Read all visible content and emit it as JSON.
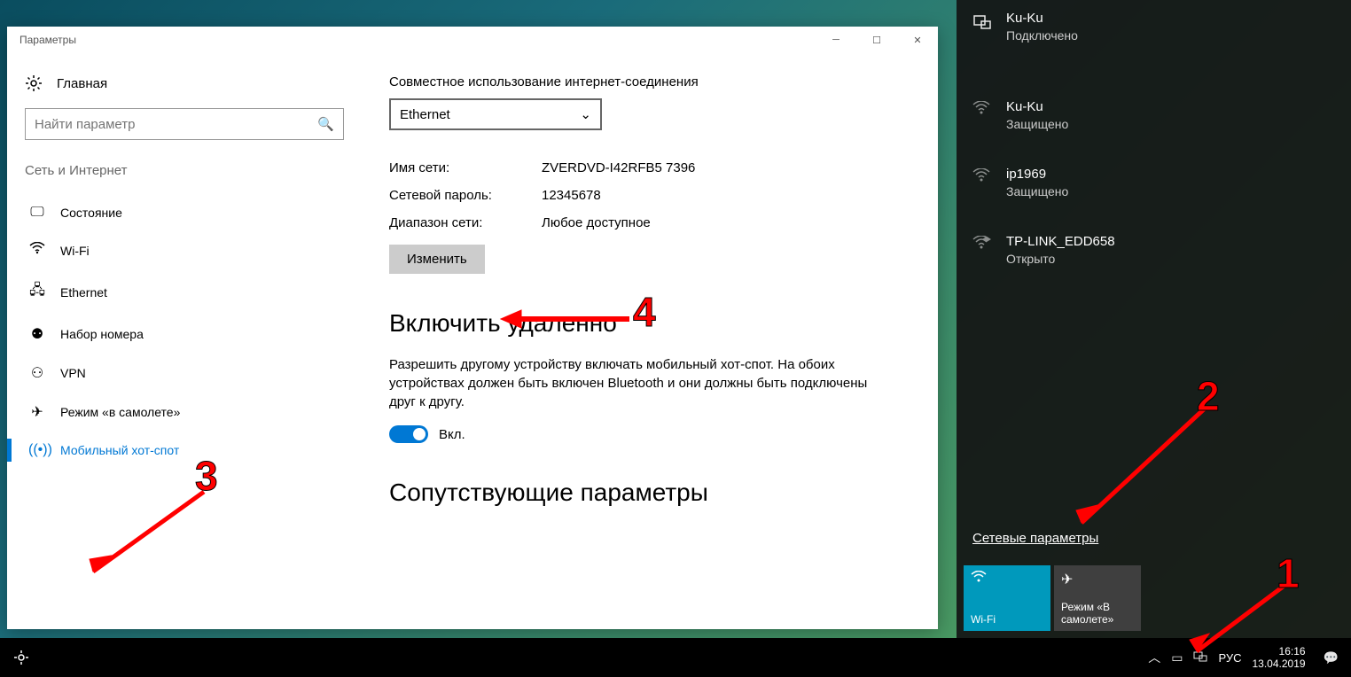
{
  "window": {
    "title": "Параметры"
  },
  "sidebar": {
    "home": "Главная",
    "search_placeholder": "Найти параметр",
    "section": "Сеть и Интернет",
    "items": [
      {
        "icon": "⊞",
        "label": "Состояние"
      },
      {
        "icon": "wifi",
        "label": "Wi-Fi"
      },
      {
        "icon": "🖧",
        "label": "Ethernet"
      },
      {
        "icon": "☎",
        "label": "Набор номера"
      },
      {
        "icon": "vpn",
        "label": "VPN"
      },
      {
        "icon": "✈",
        "label": "Режим «в самолете»"
      },
      {
        "icon": "hotspot",
        "label": "Мобильный хот-спот"
      }
    ]
  },
  "content": {
    "share_label": "Совместное использование интернет-соединения",
    "share_value": "Ethernet",
    "props": [
      {
        "key": "Имя сети:",
        "val": "ZVERDVD-I42RFB5 7396"
      },
      {
        "key": "Сетевой пароль:",
        "val": "12345678"
      },
      {
        "key": "Диапазон сети:",
        "val": "Любое доступное"
      }
    ],
    "change_btn": "Изменить",
    "remote_title": "Включить удаленно",
    "remote_desc": "Разрешить другому устройству включать мобильный хот-спот. На обоих устройствах должен быть включен Bluetooth и они должны быть подключены друг к другу.",
    "toggle_label": "Вкл.",
    "related_title": "Сопутствующие параметры"
  },
  "flyout": {
    "networks": [
      {
        "icon": "ethernet",
        "name": "Ku-Ku",
        "status": "Подключено",
        "dim": false
      },
      {
        "icon": "wifi",
        "name": "Ku-Ku",
        "status": "Защищено",
        "dim": true
      },
      {
        "icon": "wifi",
        "name": "ip1969",
        "status": "Защищено",
        "dim": true
      },
      {
        "icon": "wifi-open",
        "name": "TP-LINK_EDD658",
        "status": "Открыто",
        "dim": true
      }
    ],
    "settings_link": "Сетевые параметры",
    "tiles": [
      {
        "label": "Wi-Fi",
        "active": true,
        "icon": "wifi"
      },
      {
        "label": "Режим «В самолете»",
        "active": false,
        "icon": "✈"
      }
    ]
  },
  "taskbar": {
    "lang": "РУС",
    "time": "16:16",
    "date": "13.04.2019"
  },
  "annotations": {
    "n1": "1",
    "n2": "2",
    "n3": "3",
    "n4": "4"
  }
}
